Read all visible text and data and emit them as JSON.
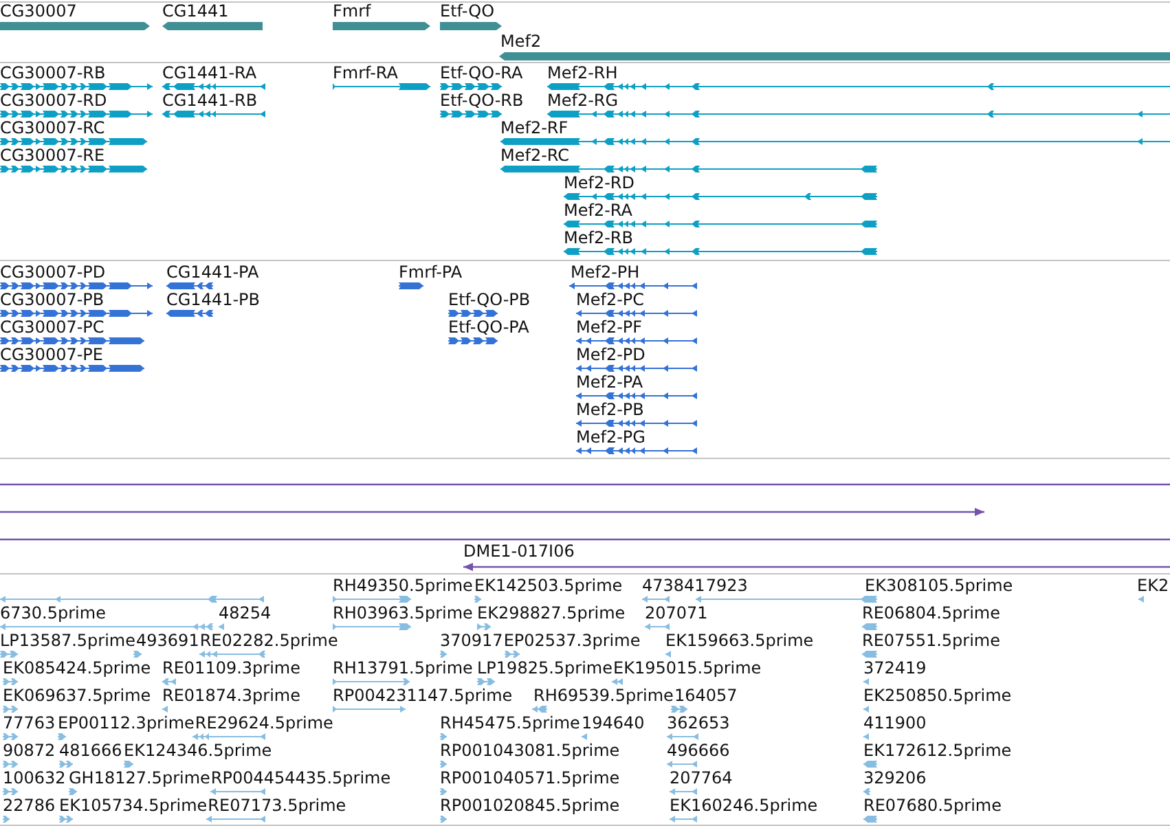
{
  "tracks": [
    {
      "kind": "gene",
      "features": [
        {
          "label": "CG30007",
          "reverse": false
        },
        {
          "label": "CG1441",
          "reverse": true
        },
        {
          "label": "Fmrf",
          "reverse": false
        },
        {
          "label": "Etf-QO",
          "reverse": false
        },
        {
          "label": "Mef2",
          "reverse": true
        }
      ]
    },
    {
      "kind": "transcript",
      "features": [
        {
          "label": "CG30007-RB",
          "reverse": false
        },
        {
          "label": "CG1441-RA",
          "reverse": true
        },
        {
          "label": "Fmrf-RA",
          "reverse": false
        },
        {
          "label": "Etf-QO-RA",
          "reverse": false
        },
        {
          "label": "Mef2-RH",
          "reverse": true
        },
        {
          "label": "CG30007-RD",
          "reverse": false
        },
        {
          "label": "CG1441-RB",
          "reverse": true
        },
        {
          "label": "Etf-QO-RB",
          "reverse": false
        },
        {
          "label": "Mef2-RG",
          "reverse": true
        },
        {
          "label": "CG30007-RC",
          "reverse": false
        },
        {
          "label": "Mef2-RF",
          "reverse": true
        },
        {
          "label": "CG30007-RE",
          "reverse": false
        },
        {
          "label": "Mef2-RC",
          "reverse": true
        },
        {
          "label": "Mef2-RD",
          "reverse": true
        },
        {
          "label": "Mef2-RA",
          "reverse": true
        },
        {
          "label": "Mef2-RB",
          "reverse": true
        }
      ]
    },
    {
      "kind": "protein",
      "features": [
        {
          "label": "CG30007-PD",
          "reverse": false
        },
        {
          "label": "CG1441-PA",
          "reverse": true
        },
        {
          "label": "Fmrf-PA",
          "reverse": false
        },
        {
          "label": "Mef2-PH",
          "reverse": true
        },
        {
          "label": "CG30007-PB",
          "reverse": false
        },
        {
          "label": "CG1441-PB",
          "reverse": true
        },
        {
          "label": "Etf-QO-PB",
          "reverse": false
        },
        {
          "label": "Mef2-PC",
          "reverse": true
        },
        {
          "label": "CG30007-PC",
          "reverse": false
        },
        {
          "label": "Etf-QO-PA",
          "reverse": false
        },
        {
          "label": "Mef2-PF",
          "reverse": true
        },
        {
          "label": "CG30007-PE",
          "reverse": false
        },
        {
          "label": "Mef2-PD",
          "reverse": true
        },
        {
          "label": "Mef2-PA",
          "reverse": true
        },
        {
          "label": "Mef2-PB",
          "reverse": true
        },
        {
          "label": "Mef2-PG",
          "reverse": true
        }
      ]
    },
    {
      "kind": "clone",
      "features": [
        {
          "kind": "plain"
        },
        {
          "kind": "arrow",
          "reverse": false
        },
        {
          "kind": "plain"
        },
        {
          "kind": "arrow",
          "label": "DME1-017I06",
          "reverse": true
        }
      ]
    },
    {
      "kind": "est",
      "features": [
        {
          "reverse": true
        },
        {
          "label": "RH49350.5prime",
          "reverse": false
        },
        {
          "label": "EK142503.5prime",
          "reverse": false
        },
        {
          "label": "473841",
          "reverse": true
        },
        {
          "label": "7923",
          "reverse": true
        },
        {
          "label": "EK308105.5prime",
          "reverse": true
        },
        {
          "label": "EK2",
          "reverse": true
        },
        {
          "label": "6730.5prime",
          "reverse": true
        },
        {
          "label": "48254",
          "reverse": true
        },
        {
          "label": "RH03963.5prime",
          "reverse": false
        },
        {
          "label": "EK298827.5prime",
          "reverse": false
        },
        {
          "label": "207071",
          "reverse": true
        },
        {
          "label": "RE06804.5prime",
          "reverse": true
        },
        {
          "label": "LP13587.5prime",
          "reverse": false
        },
        {
          "label": "493691",
          "reverse": false
        },
        {
          "label": "RE02282.5prime",
          "reverse": true
        },
        {
          "label": "370917",
          "reverse": false
        },
        {
          "label": "EP02537.3prime",
          "reverse": false
        },
        {
          "label": "EK159663.5prime",
          "reverse": true
        },
        {
          "label": "RE07551.5prime",
          "reverse": true
        },
        {
          "label": "EK085424.5prime",
          "reverse": false
        },
        {
          "label": "RE01109.3prime",
          "reverse": true
        },
        {
          "label": "RH13791.5prime",
          "reverse": false
        },
        {
          "label": "LP19825.5prime",
          "reverse": false
        },
        {
          "label": "EK195015.5prime",
          "reverse": true
        },
        {
          "label": "372419",
          "reverse": true
        },
        {
          "label": "EK069637.5prime",
          "reverse": false
        },
        {
          "label": "RE01874.3prime",
          "reverse": true
        },
        {
          "label": "RP004231147.5prime",
          "reverse": false
        },
        {
          "label": "RH69539.5prime",
          "reverse": true
        },
        {
          "label": "164057",
          "reverse": false
        },
        {
          "label": "EK250850.5prime",
          "reverse": true
        },
        {
          "label": "77763",
          "reverse": false
        },
        {
          "label": "EP00112.3prime",
          "reverse": false
        },
        {
          "label": "RE29624.5prime",
          "reverse": true
        },
        {
          "label": "RH45475.5prime",
          "reverse": false
        },
        {
          "label": "194640",
          "reverse": true
        },
        {
          "label": "362653",
          "reverse": true
        },
        {
          "label": "411900",
          "reverse": true
        },
        {
          "label": "90872",
          "reverse": false
        },
        {
          "label": "481666",
          "reverse": false
        },
        {
          "label": "EK124346.5prime",
          "reverse": false
        },
        {
          "label": "RP001043081.5prime",
          "reverse": false
        },
        {
          "label": "496666",
          "reverse": true
        },
        {
          "label": "EK172612.5prime",
          "reverse": true
        },
        {
          "label": "100632",
          "reverse": false
        },
        {
          "label": "GH18127.5prime",
          "reverse": false
        },
        {
          "label": "RP004454435.5prime",
          "reverse": true
        },
        {
          "label": "RP001040571.5prime",
          "reverse": false
        },
        {
          "label": "207764",
          "reverse": true
        },
        {
          "label": "329206",
          "reverse": true
        },
        {
          "label": "22786",
          "reverse": false
        },
        {
          "label": "EK105734.5prime",
          "reverse": false
        },
        {
          "label": "RE07173.5prime",
          "reverse": true
        },
        {
          "label": "RP001020845.5prime",
          "reverse": false
        },
        {
          "label": "EK160246.5prime",
          "reverse": true
        },
        {
          "label": "RE07680.5prime",
          "reverse": true
        }
      ]
    }
  ]
}
